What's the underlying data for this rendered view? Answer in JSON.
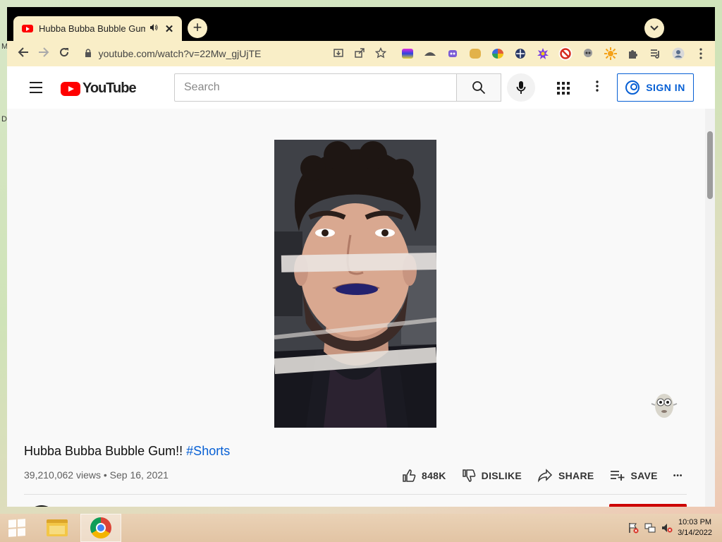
{
  "desktop": {
    "label_m": "M",
    "label_d": "D"
  },
  "browser": {
    "tab": {
      "title": "Hubba Bubba Bubble Gum!! - YouTube",
      "audio_icon": "speaker-icon",
      "close": "✕"
    },
    "new_tab": "+",
    "tab_search": "⌄",
    "url": "youtube.com/watch?v=22Mw_gjUjTE",
    "extensions": [
      {
        "name": "ext-rainbow-icon",
        "color": "#b12ce0"
      },
      {
        "name": "ext-hat-icon",
        "color": "#555555"
      },
      {
        "name": "ext-alien-icon",
        "color": "#7b5cd6"
      },
      {
        "name": "ext-doge-icon",
        "color": "#e2b24a"
      },
      {
        "name": "ext-wheel-icon",
        "color": "#e05a3a"
      },
      {
        "name": "ext-compass-icon",
        "color": "#2b3a67"
      },
      {
        "name": "ext-burst-icon",
        "color": "#7b3fe0"
      },
      {
        "name": "ext-block-icon",
        "color": "#d62d20"
      },
      {
        "name": "ext-skull-icon",
        "color": "#9a9a9a"
      },
      {
        "name": "ext-sun-icon",
        "color": "#f4a21a"
      }
    ]
  },
  "youtube": {
    "logo_text": "YouTube",
    "search_placeholder": "Search",
    "sign_in": "SIGN IN",
    "video": {
      "title": "Hubba Bubba Bubble Gum!!",
      "hashtag": "#Shorts",
      "views": "39,210,062 views",
      "separator": "•",
      "date": "Sep 16, 2021"
    },
    "actions": {
      "likes": "848K",
      "dislike": "DISLIKE",
      "share": "SHARE",
      "save": "SAVE",
      "more": "•••"
    }
  },
  "taskbar": {
    "time": "10:03 PM",
    "date": "3/14/2022",
    "tray": [
      "flag-icon",
      "network-icon",
      "volume-muted-icon"
    ]
  },
  "colors": {
    "accent_blue": "#065fd4",
    "youtube_red": "#ff0000",
    "chrome_toolbar": "#f9eec7"
  }
}
